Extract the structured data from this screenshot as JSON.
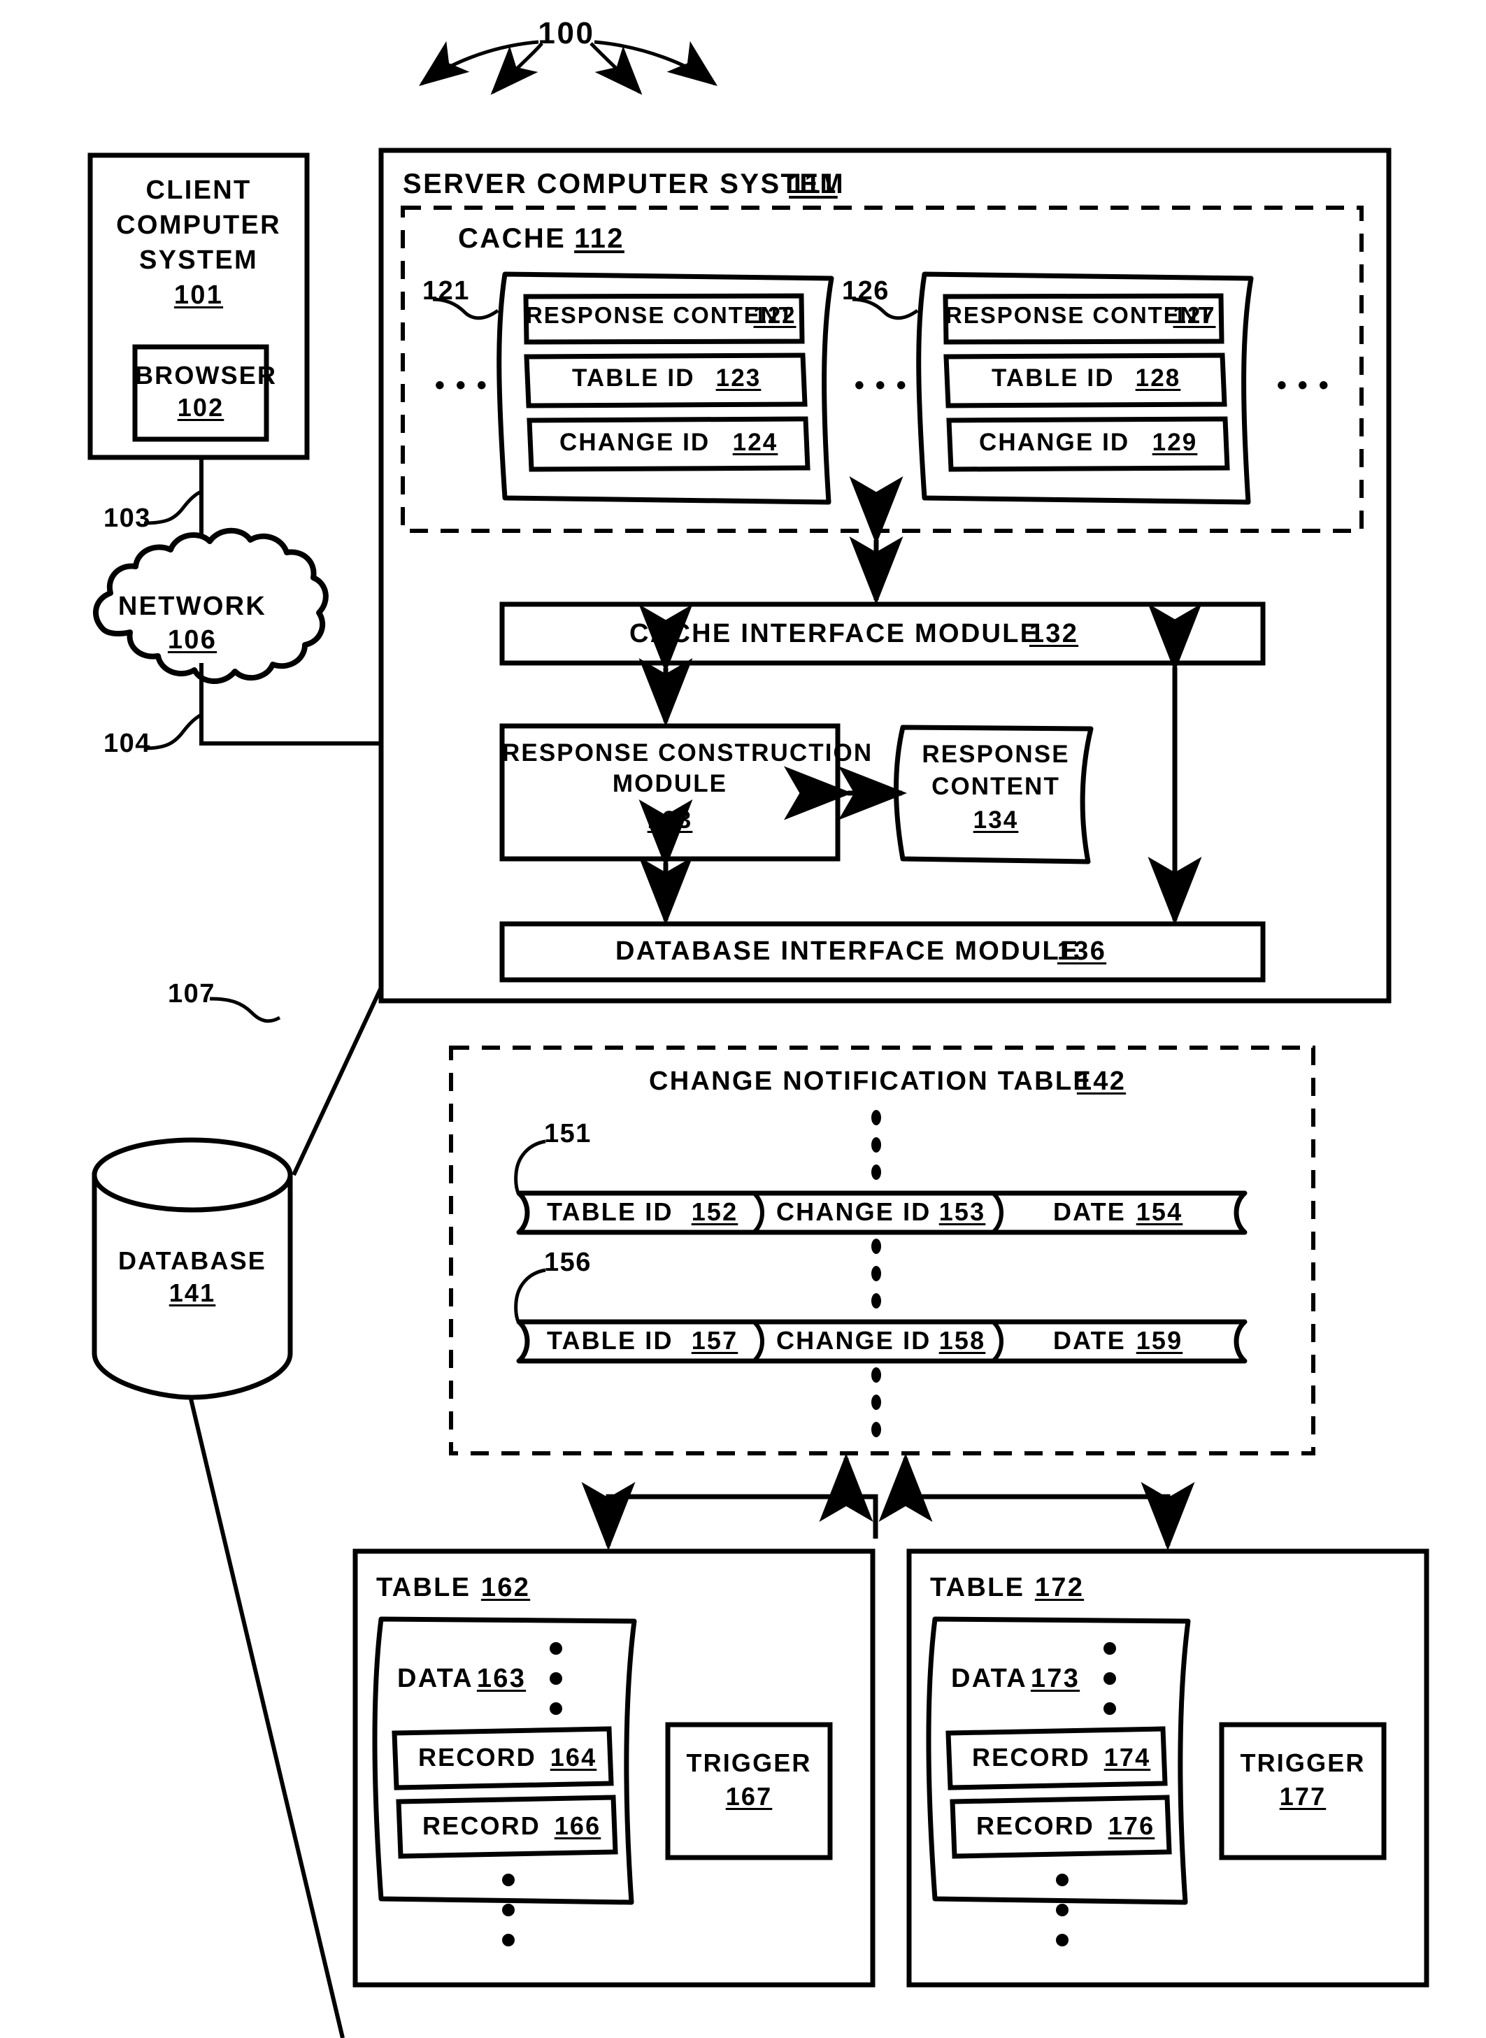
{
  "figure": {
    "callout_number": "100",
    "client": {
      "title_line1": "CLIENT",
      "title_line2": "COMPUTER",
      "title_line3": "SYSTEM",
      "ref": "101",
      "browser_label": "BROWSER",
      "browser_ref": "102"
    },
    "links": {
      "client_to_network": "103",
      "network_to_server": "104",
      "server_to_database": "107"
    },
    "network": {
      "label": "NETWORK",
      "ref": "106"
    },
    "server": {
      "title": "SERVER COMPUTER SYSTEM",
      "ref": "111",
      "cache": {
        "title": "CACHE",
        "ref": "112",
        "entries": [
          {
            "entry_ref": "121",
            "rows": [
              {
                "label": "RESPONSE CONTENT",
                "ref": "122"
              },
              {
                "label": "TABLE ID",
                "ref": "123"
              },
              {
                "label": "CHANGE ID",
                "ref": "124"
              }
            ]
          },
          {
            "entry_ref": "126",
            "rows": [
              {
                "label": "RESPONSE CONTENT",
                "ref": "127"
              },
              {
                "label": "TABLE ID",
                "ref": "128"
              },
              {
                "label": "CHANGE ID",
                "ref": "129"
              }
            ]
          }
        ],
        "ellipsis_left": "• • •",
        "ellipsis_middle": "• • •",
        "ellipsis_right": "• • •"
      },
      "cache_interface_module": {
        "label": "CACHE INTERFACE MODULE",
        "ref": "132"
      },
      "response_construction_module": {
        "line1": "RESPONSE CONSTRUCTION",
        "line2": "MODULE",
        "ref": "133"
      },
      "response_content_doc": {
        "line1": "RESPONSE",
        "line2": "CONTENT",
        "ref": "134"
      },
      "database_interface_module": {
        "label": "DATABASE INTERFACE MODULE",
        "ref": "136"
      }
    },
    "database": {
      "label": "DATABASE",
      "ref": "141"
    },
    "change_notification_table": {
      "title": "CHANGE NOTIFICATION TABLE",
      "ref": "142",
      "rows": [
        {
          "row_ref": "151",
          "cells": [
            {
              "label": "TABLE ID",
              "ref": "152"
            },
            {
              "label": "CHANGE ID",
              "ref": "153"
            },
            {
              "label": "DATE",
              "ref": "154"
            }
          ]
        },
        {
          "row_ref": "156",
          "cells": [
            {
              "label": "TABLE ID",
              "ref": "157"
            },
            {
              "label": "CHANGE ID",
              "ref": "158"
            },
            {
              "label": "DATE",
              "ref": "159"
            }
          ]
        }
      ]
    },
    "tables": [
      {
        "title": "TABLE",
        "ref": "162",
        "data_label": "DATA",
        "data_ref": "163",
        "records": [
          {
            "label": "RECORD",
            "ref": "164"
          },
          {
            "label": "RECORD",
            "ref": "166"
          }
        ],
        "trigger_label": "TRIGGER",
        "trigger_ref": "167"
      },
      {
        "title": "TABLE",
        "ref": "172",
        "data_label": "DATA",
        "data_ref": "173",
        "records": [
          {
            "label": "RECORD",
            "ref": "174"
          },
          {
            "label": "RECORD",
            "ref": "176"
          }
        ],
        "trigger_label": "TRIGGER",
        "trigger_ref": "177"
      }
    ]
  },
  "colors": {
    "ink": "#000000",
    "paper": "#ffffff"
  }
}
